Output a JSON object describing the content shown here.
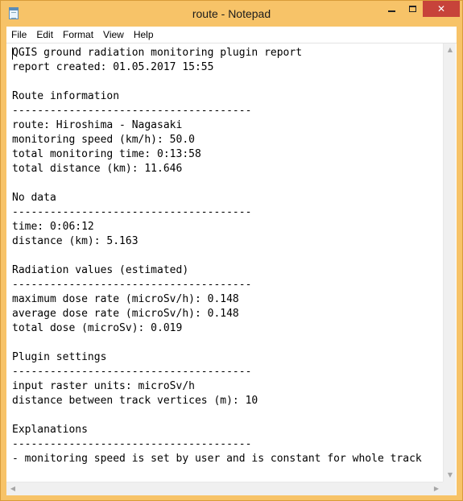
{
  "window": {
    "title": "route - Notepad",
    "close_glyph": "✕"
  },
  "menu": [
    "File",
    "Edit",
    "Format",
    "View",
    "Help"
  ],
  "document": {
    "lines": [
      "QGIS ground radiation monitoring plugin report",
      "report created: 01.05.2017 15:55",
      "",
      "Route information",
      "--------------------------------------",
      "route: Hiroshima - Nagasaki",
      "monitoring speed (km/h): 50.0",
      "total monitoring time: 0:13:58",
      "total distance (km): 11.646",
      "",
      "No data",
      "--------------------------------------",
      "time: 0:06:12",
      "distance (km): 5.163",
      "",
      "Radiation values (estimated)",
      "--------------------------------------",
      "maximum dose rate (microSv/h): 0.148",
      "average dose rate (microSv/h): 0.148",
      "total dose (microSv): 0.019",
      "",
      "Plugin settings",
      "--------------------------------------",
      "input raster units: microSv/h",
      "distance between track vertices (m): 10",
      "",
      "Explanations",
      "--------------------------------------",
      "- monitoring speed is set by user and is constant for whole track"
    ]
  },
  "icons": {
    "app": "notepad-icon",
    "minimize": "minimize-icon",
    "maximize": "maximize-icon",
    "close": "close-icon"
  }
}
